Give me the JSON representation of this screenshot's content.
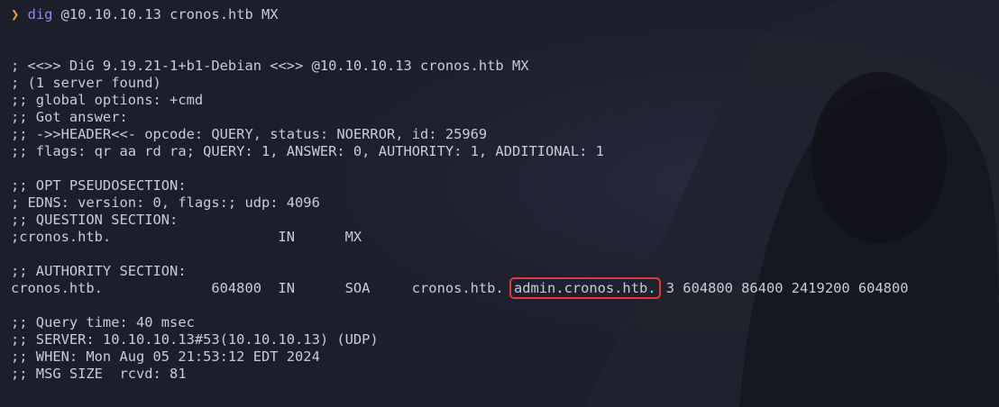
{
  "prompt": {
    "symbol": "❯",
    "command": "dig",
    "args": " @10.10.10.13 cronos.htb MX"
  },
  "output": {
    "l1": "; <<>> DiG 9.19.21-1+b1-Debian <<>> @10.10.10.13 cronos.htb MX",
    "l2": "; (1 server found)",
    "l3": ";; global options: +cmd",
    "l4": ";; Got answer:",
    "l5": ";; ->>HEADER<<- opcode: QUERY, status: NOERROR, id: 25969",
    "l6": ";; flags: qr aa rd ra; QUERY: 1, ANSWER: 0, AUTHORITY: 1, ADDITIONAL: 1",
    "l7": ";; OPT PSEUDOSECTION:",
    "l8": "; EDNS: version: 0, flags:; udp: 4096",
    "l9": ";; QUESTION SECTION:",
    "l10": ";cronos.htb.                    IN      MX",
    "l11": ";; AUTHORITY SECTION:",
    "soa_prefix": "cronos.htb.             604800  IN      SOA     cronos.htb. ",
    "soa_highlight": "admin.cronos.htb.",
    "soa_suffix": " 3 604800 86400 2419200 604800",
    "l12": ";; Query time: 40 msec",
    "l13": ";; SERVER: 10.10.10.13#53(10.10.10.13) (UDP)",
    "l14": ";; WHEN: Mon Aug 05 21:53:12 EDT 2024",
    "l15": ";; MSG SIZE  rcvd: 81"
  },
  "colors": {
    "background": "#1c1e2c",
    "text": "#c9ccd6",
    "prompt_arrow": "#f0a030",
    "command": "#9a86e8",
    "highlight_box": "#e4383c"
  }
}
